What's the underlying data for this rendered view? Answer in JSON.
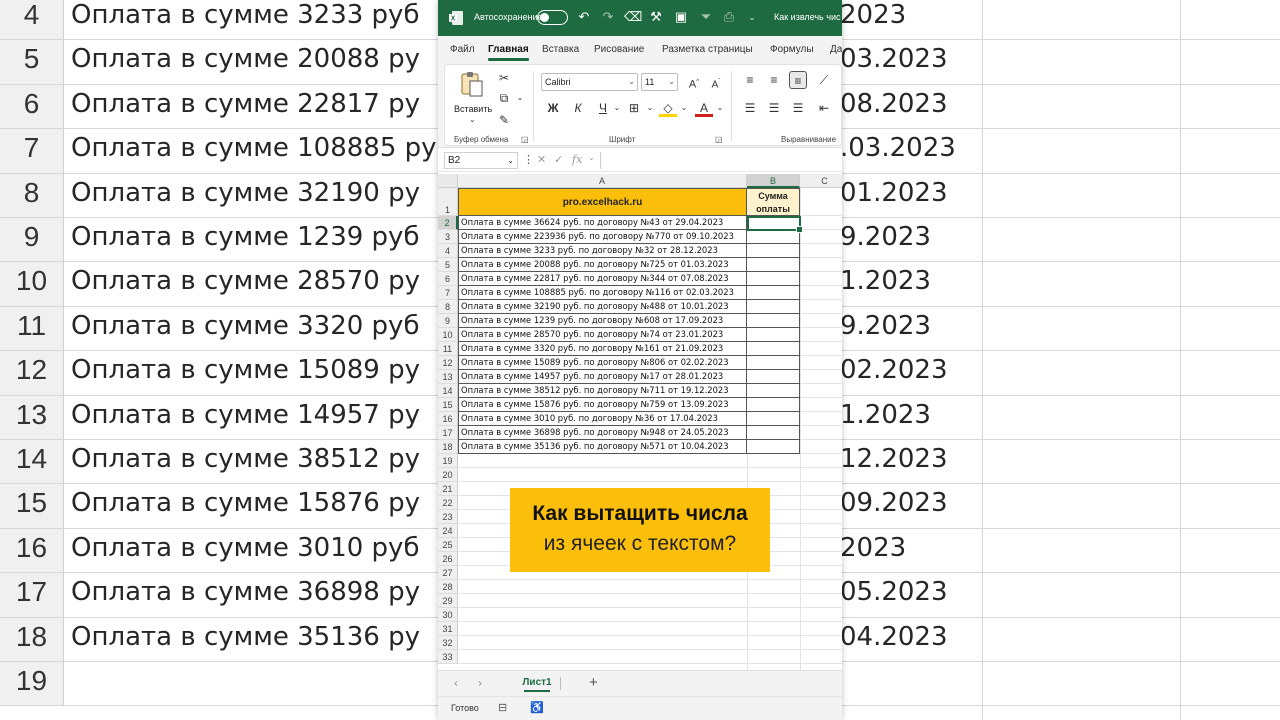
{
  "background": {
    "rows": [
      {
        "num": "4",
        "text": "Оплата в сумме 3233 руб",
        "date": "2023"
      },
      {
        "num": "5",
        "text": "Оплата в сумме 20088 ру",
        "date": "03.2023"
      },
      {
        "num": "6",
        "text": "Оплата в сумме 22817 ру",
        "date": "08.2023"
      },
      {
        "num": "7",
        "text": "Оплата в сумме 108885 ру",
        "date": ".03.2023"
      },
      {
        "num": "8",
        "text": "Оплата в сумме 32190 ру",
        "date": "01.2023"
      },
      {
        "num": "9",
        "text": "Оплата в сумме 1239 руб",
        "date": "9.2023"
      },
      {
        "num": "10",
        "text": "Оплата в сумме 28570 ру",
        "date": "1.2023"
      },
      {
        "num": "11",
        "text": "Оплата в сумме 3320 руб",
        "date": "9.2023"
      },
      {
        "num": "12",
        "text": "Оплата в сумме 15089 ру",
        "date": "02.2023"
      },
      {
        "num": "13",
        "text": "Оплата в сумме 14957 ру",
        "date": "1.2023"
      },
      {
        "num": "14",
        "text": "Оплата в сумме 38512 ру",
        "date": "12.2023"
      },
      {
        "num": "15",
        "text": "Оплата в сумме 15876 ру",
        "date": "09.2023"
      },
      {
        "num": "16",
        "text": "Оплата в сумме 3010 руб",
        "date": "2023"
      },
      {
        "num": "17",
        "text": "Оплата в сумме 36898 ру",
        "date": "05.2023"
      },
      {
        "num": "18",
        "text": "Оплата в сумме 35136 ру",
        "date": "04.2023"
      },
      {
        "num": "19",
        "text": "",
        "date": ""
      }
    ]
  },
  "titlebar": {
    "autosave_label": "Автосохранение",
    "doc_title": "Как извлечь чис"
  },
  "tabs": [
    "Файл",
    "Главная",
    "Вставка",
    "Рисование",
    "Разметка страницы",
    "Формулы",
    "Да"
  ],
  "ribbon": {
    "paste_label": "Вставить",
    "clipboard_group": "Буфер обмена",
    "font_name": "Calibri",
    "font_size": "11",
    "font_group": "Шрифт",
    "align_group": "Выравнивание",
    "bold": "Ж",
    "italic": "К",
    "underline": "Ч"
  },
  "formula_bar": {
    "name_box": "B2",
    "fx": "fx"
  },
  "grid": {
    "columns": [
      "A",
      "B",
      "C"
    ],
    "header_a": "pro.excelhack.ru",
    "header_b_line1": "Сумма",
    "header_b_line2": "оплаты",
    "rows": [
      "Оплата в сумме 36624 руб. по договору №43 от 29.04.2023",
      "Оплата в сумме 223936 руб. по договору №770 от 09.10.2023",
      "Оплата в сумме 3233 руб. по договору №32 от 28.12.2023",
      "Оплата в сумме 20088 руб. по договору №725 от 01.03.2023",
      "Оплата в сумме 22817 руб. по договору №344 от 07.08.2023",
      "Оплата в сумме 108885 руб. по договору №116 от 02.03.2023",
      "Оплата в сумме 32190 руб. по договору №488 от 10.01.2023",
      "Оплата в сумме 1239 руб. по договору №608 от 17.09.2023",
      "Оплата в сумме 28570 руб. по договору №74 от 23.01.2023",
      "Оплата в сумме 3320 руб. по договору №161 от 21.09.2023",
      "Оплата в сумме 15089 руб. по договору №806 от 02.02.2023",
      "Оплата в сумме 14957 руб. по договору №17 от 28.01.2023",
      "Оплата в сумме 38512 руб. по договору №711 от 19.12.2023",
      "Оплата в сумме 15876 руб. по договору №759 от 13.09.2023",
      "Оплата в сумме 3010 руб. по договору №36 от 17.04.2023",
      "Оплата в сумме 36898 руб. по договору №948 от 24.05.2023",
      "Оплата в сумме 35136 руб. по договору №571 от 10.04.2023"
    ],
    "row_numbers": [
      "1",
      "2",
      "3",
      "4",
      "5",
      "6",
      "7",
      "8",
      "9",
      "10",
      "11",
      "12",
      "13",
      "14",
      "15",
      "16",
      "17",
      "18",
      "19",
      "20",
      "21",
      "22",
      "23",
      "24",
      "25",
      "26",
      "27",
      "28",
      "29",
      "30",
      "31",
      "32",
      "33"
    ]
  },
  "callout": {
    "line1": "Как вытащить числа",
    "line2": "из ячеек с текстом?"
  },
  "sheet_tabs": {
    "active": "Лист1",
    "add": "+"
  },
  "status": {
    "ready": "Готово"
  },
  "colors": {
    "accent": "#1f6b41",
    "header_fill": "#fbbf0b",
    "header_b_fill": "#fff2cc"
  }
}
